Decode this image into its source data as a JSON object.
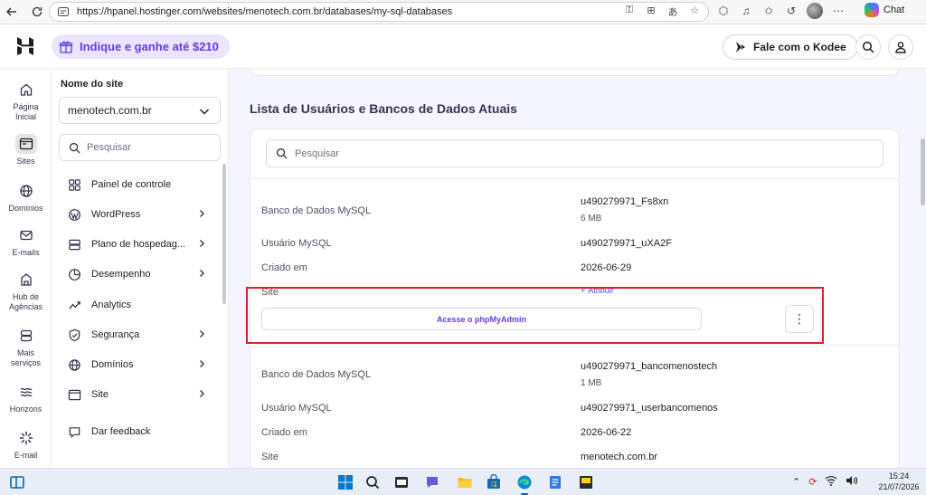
{
  "browser": {
    "url": "https://hpanel.hostinger.com/websites/menotech.com.br/databases/my-sql-databases",
    "chat_label": "Chat"
  },
  "header": {
    "refer_label": "Indique e ganhe até $210",
    "kodee_label": "Fale com o Kodee"
  },
  "rail": {
    "items": [
      {
        "label": "Página Inicial",
        "icon": "home-icon"
      },
      {
        "label": "Sites",
        "icon": "browser-window-icon"
      },
      {
        "label": "Domínios",
        "icon": "globe-icon"
      },
      {
        "label": "E-mails",
        "icon": "mail-icon"
      },
      {
        "label": "Hub de Agências",
        "icon": "agency-hub-icon"
      },
      {
        "label": "Mais serviços",
        "icon": "server-icon"
      },
      {
        "label": "Horizons",
        "icon": "horizons-icon"
      },
      {
        "label": "E-mail",
        "icon": "sparkle-icon"
      }
    ]
  },
  "sidebar": {
    "site_label": "Nome do site",
    "selected_site": "menotech.com.br",
    "search_placeholder": "Pesquisar",
    "items": [
      {
        "label": "Painel de controle",
        "icon": "dashboard-icon",
        "arrow": false
      },
      {
        "label": "WordPress",
        "icon": "wordpress-icon",
        "arrow": true
      },
      {
        "label": "Plano de hospedag...",
        "icon": "hosting-plan-icon",
        "arrow": true
      },
      {
        "label": "Desempenho",
        "icon": "performance-icon",
        "arrow": true
      },
      {
        "label": "Analytics",
        "icon": "analytics-icon",
        "arrow": false
      },
      {
        "label": "Segurança",
        "icon": "shield-icon",
        "arrow": true
      },
      {
        "label": "Domínios",
        "icon": "globe-icon",
        "arrow": true
      },
      {
        "label": "Site",
        "icon": "site-icon",
        "arrow": true
      },
      {
        "label": "Dar feedback",
        "icon": "feedback-icon",
        "arrow": false
      }
    ]
  },
  "main": {
    "section_title": "Lista de Usuários e Bancos de Dados Atuais",
    "search_placeholder": "Pesquisar",
    "labels": {
      "db": "Banco de Dados MySQL",
      "user": "Usuário MySQL",
      "created": "Criado em",
      "site": "Site"
    },
    "databases": [
      {
        "db_name": "u490279971_Fs8xn",
        "size": "6 MB",
        "user": "u490279971_uXA2F",
        "created": "2026-06-29",
        "site": "Atribuir",
        "pma_label": "Acesse o phpMyAdmin",
        "more": "⋮"
      },
      {
        "db_name": "u490279971_bancomenostech",
        "size": "1 MB",
        "user": "u490279971_userbancomenos",
        "created": "2026-06-22",
        "site": "menotech.com.br"
      }
    ]
  },
  "taskbar": {
    "time": "15:24",
    "date": "21/07/2026"
  },
  "colors": {
    "brand": "#673de6",
    "highlight": "#e0202b",
    "main_bg": "#f4f5ff"
  }
}
